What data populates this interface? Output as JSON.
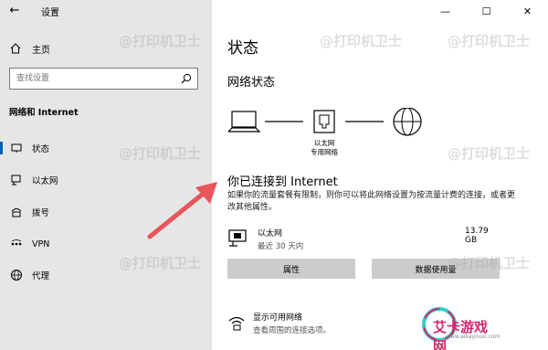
{
  "window": {
    "title": "设置",
    "caption": {
      "minimize": "—",
      "maximize": "☐",
      "close": "✕"
    }
  },
  "sidebar": {
    "home_label": "主页",
    "search_placeholder": "查找设置",
    "section_title": "网络和 Internet",
    "items": [
      {
        "label": "状态",
        "icon": "home-network-icon",
        "active": true
      },
      {
        "label": "以太网",
        "icon": "ethernet-icon",
        "active": false
      },
      {
        "label": "拨号",
        "icon": "dialup-icon",
        "active": false
      },
      {
        "label": "VPN",
        "icon": "vpn-icon",
        "active": false
      },
      {
        "label": "代理",
        "icon": "globe-icon",
        "active": false
      }
    ]
  },
  "main": {
    "title": "状态",
    "network_status_heading": "网络状态",
    "diagram": {
      "middle_label_line1": "以太网",
      "middle_label_line2": "专用网络"
    },
    "connected_heading": "你已连接到 Internet",
    "description": "如果你的流量套餐有限制，则你可以将此网络设置为按流量计费的连接，或者更改其他属性。",
    "adapter": {
      "name": "以太网",
      "sub": "最近 30 天内",
      "usage": "13.79 GB"
    },
    "buttons": {
      "properties": "属性",
      "data_usage": "数据使用量"
    },
    "show_networks": {
      "title": "显示可用网络",
      "sub": "查看周围的连接选项。"
    }
  },
  "overlays": {
    "watermark_text": "@打印机卫士",
    "badge_text": "艾卡游戏网",
    "badge_sub": "www.aikayouxi.com",
    "arrow_color": "#e8555a",
    "accent_color": "#0063b1"
  }
}
